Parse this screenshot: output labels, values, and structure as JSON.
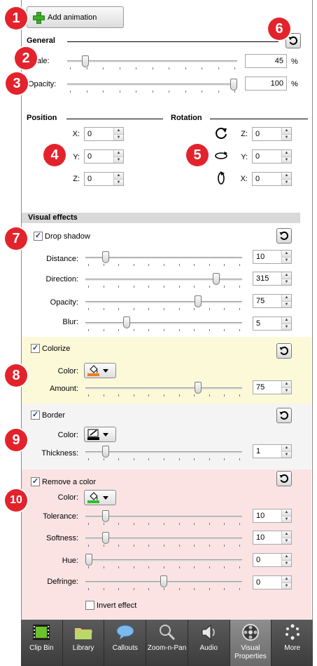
{
  "toolbar": {
    "add_animation": "Add animation"
  },
  "general": {
    "title": "General",
    "scale_label": "Scale:",
    "scale_value": "45",
    "scale_unit": "%",
    "opacity_label": "Opacity:",
    "opacity_value": "100",
    "opacity_unit": "%",
    "scale_level": 0.09,
    "opacity_level": 1.0
  },
  "position": {
    "title": "Position",
    "x_label": "X:",
    "x_value": "0",
    "y_label": "Y:",
    "y_value": "0",
    "z_label": "Z:",
    "z_value": "0"
  },
  "rotation": {
    "title": "Rotation",
    "z_label": "Z:",
    "z_value": "0",
    "y_label": "Y:",
    "y_value": "0",
    "x_label": "X:",
    "x_value": "0"
  },
  "visual_effects": {
    "title": "Visual effects"
  },
  "drop_shadow": {
    "label": "Drop shadow",
    "checked": true,
    "distance_label": "Distance:",
    "distance_value": "10",
    "direction_label": "Direction:",
    "direction_value": "315",
    "opacity_label": "Opacity:",
    "opacity_value": "75",
    "blur_label": "Blur:",
    "blur_value": "5",
    "distance_level": 0.11,
    "direction_level": 0.85,
    "opacity_level": 0.73,
    "blur_level": 0.25
  },
  "colorize": {
    "label": "Colorize",
    "checked": true,
    "color_label": "Color:",
    "amount_label": "Amount:",
    "amount_value": "75",
    "amount_level": 0.73,
    "swatch_color": "#f07b1c",
    "band_color": "#fbf9d8"
  },
  "border": {
    "label": "Border",
    "checked": true,
    "color_label": "Color:",
    "thickness_label": "Thickness:",
    "thickness_value": "1",
    "thickness_level": 0.11,
    "swatch_color": "#000000",
    "band_color": "#f4f4f4"
  },
  "remove_color": {
    "label": "Remove a color",
    "checked": true,
    "color_label": "Color:",
    "tolerance_label": "Tolerance:",
    "tolerance_value": "10",
    "softness_label": "Softness:",
    "softness_value": "10",
    "hue_label": "Hue:",
    "hue_value": "0",
    "defringe_label": "Defringe:",
    "defringe_value": "0",
    "invert_label": "Invert effect",
    "tolerance_level": 0.11,
    "softness_level": 0.11,
    "hue_level": 0.0,
    "defringe_level": 0.5,
    "swatch_color": "#2fbf2a",
    "band_color": "#fbe3e3"
  },
  "callouts": [
    "1",
    "2",
    "3",
    "4",
    "5",
    "6",
    "7",
    "8",
    "9",
    "10"
  ],
  "tabs": [
    {
      "label": "Clip Bin",
      "icon": "film-icon"
    },
    {
      "label": "Library",
      "icon": "folder-icon"
    },
    {
      "label": "Callouts",
      "icon": "speech-bubble-icon"
    },
    {
      "label": "Zoom-n-Pan",
      "icon": "magnifier-icon"
    },
    {
      "label": "Audio",
      "icon": "speaker-icon"
    },
    {
      "label": "Visual Properties",
      "icon": "film-reel-icon",
      "active": true
    },
    {
      "label": "More",
      "icon": "more-dots-icon"
    }
  ],
  "colors": {
    "accent_red": "#e3232c",
    "tabbar": "#4a4a4a"
  }
}
